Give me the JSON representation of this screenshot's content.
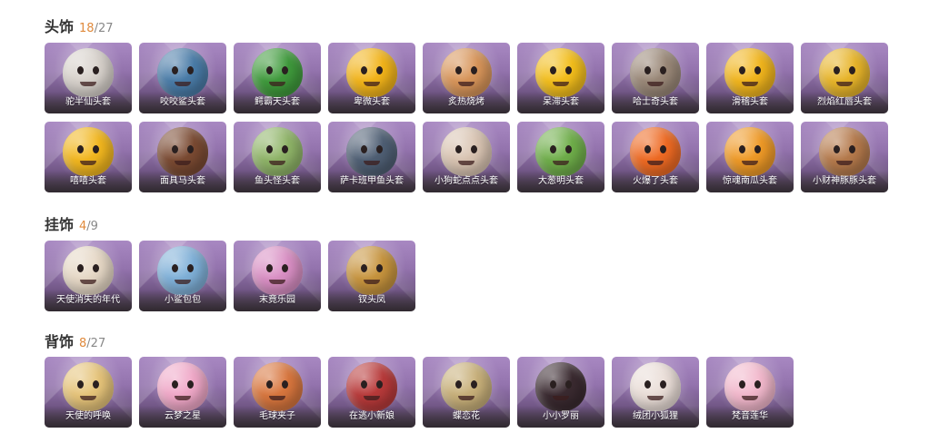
{
  "sections": [
    {
      "title": "头饰",
      "owned": "18",
      "total": "/27",
      "items": [
        {
          "label": "驼半仙头套",
          "icon": "raccoon-head-icon",
          "color": "#d8d2cc"
        },
        {
          "label": "咬咬鲨头套",
          "icon": "shark-head-icon",
          "color": "#4a7ca8"
        },
        {
          "label": "鳄霸天头套",
          "icon": "crocodile-head-icon",
          "color": "#3f9a3c"
        },
        {
          "label": "卑微头套",
          "icon": "humble-emoji-icon",
          "color": "#f2b41a"
        },
        {
          "label": "炙热烧烤",
          "icon": "barbecue-icon",
          "color": "#d8955a"
        },
        {
          "label": "呆滞头套",
          "icon": "dazed-emoji-icon",
          "color": "#f3be1c"
        },
        {
          "label": "哈士奇头套",
          "icon": "husky-head-icon",
          "color": "#9a8878"
        },
        {
          "label": "滑稽头套",
          "icon": "funny-emoji-icon",
          "color": "#f1b51d"
        },
        {
          "label": "烈焰红唇头套",
          "icon": "red-lips-head-icon",
          "color": "#e8b52a"
        },
        {
          "label": "嘻嘻头套",
          "icon": "grin-emoji-icon",
          "color": "#f2b71f"
        },
        {
          "label": "面具马头套",
          "icon": "horse-mask-icon",
          "color": "#7a4a32"
        },
        {
          "label": "鱼头怪头套",
          "icon": "fish-monster-head-icon",
          "color": "#8fb468"
        },
        {
          "label": "萨卡班甲鱼头套",
          "icon": "sacabambaspis-head-icon",
          "color": "#4f5f74"
        },
        {
          "label": "小狗蛇点点头套",
          "icon": "dog-snake-head-icon",
          "color": "#d9c4b2"
        },
        {
          "label": "大葱明头套",
          "icon": "scallion-head-icon",
          "color": "#6fae4a"
        },
        {
          "label": "火爆了头套",
          "icon": "fire-head-icon",
          "color": "#ee6a23"
        },
        {
          "label": "惊魂南瓜头套",
          "icon": "pumpkin-head-icon",
          "color": "#ef9a27"
        },
        {
          "label": "小财神豚豚头套",
          "icon": "capybara-head-icon",
          "color": "#b57a4c"
        }
      ]
    },
    {
      "title": "挂饰",
      "owned": "4",
      "total": "/9",
      "items": [
        {
          "label": "天使消失的年代",
          "icon": "angel-charm-icon",
          "color": "#e6d8c6"
        },
        {
          "label": "小鲨包包",
          "icon": "shark-bag-charm-icon",
          "color": "#7fb0d8"
        },
        {
          "label": "末竟乐园",
          "icon": "paradise-charm-icon",
          "color": "#d98fc4"
        },
        {
          "label": "钗头凤",
          "icon": "phoenix-hairpin-charm-icon",
          "color": "#c7943e"
        }
      ]
    },
    {
      "title": "背饰",
      "owned": "8",
      "total": "/27",
      "items": [
        {
          "label": "天使的呼唤",
          "icon": "angel-call-back-icon",
          "color": "#e6c47a"
        },
        {
          "label": "云梦之星",
          "icon": "cloud-dream-star-icon",
          "color": "#f0a8c8"
        },
        {
          "label": "毛球夹子",
          "icon": "fur-ball-clip-icon",
          "color": "#d8763e"
        },
        {
          "label": "在逃小新娘",
          "icon": "runaway-bride-icon",
          "color": "#b83a3a"
        },
        {
          "label": "蝶恋花",
          "icon": "butterfly-flower-icon",
          "color": "#c8b07a"
        },
        {
          "label": "小小罗丽",
          "icon": "little-lolita-icon",
          "color": "#3a2a30"
        },
        {
          "label": "绒团小狐狸",
          "icon": "fluffy-fox-icon",
          "color": "#eaded8"
        },
        {
          "label": "梵音莲华",
          "icon": "sanskrit-lotus-icon",
          "color": "#f2b8cc"
        }
      ]
    }
  ]
}
